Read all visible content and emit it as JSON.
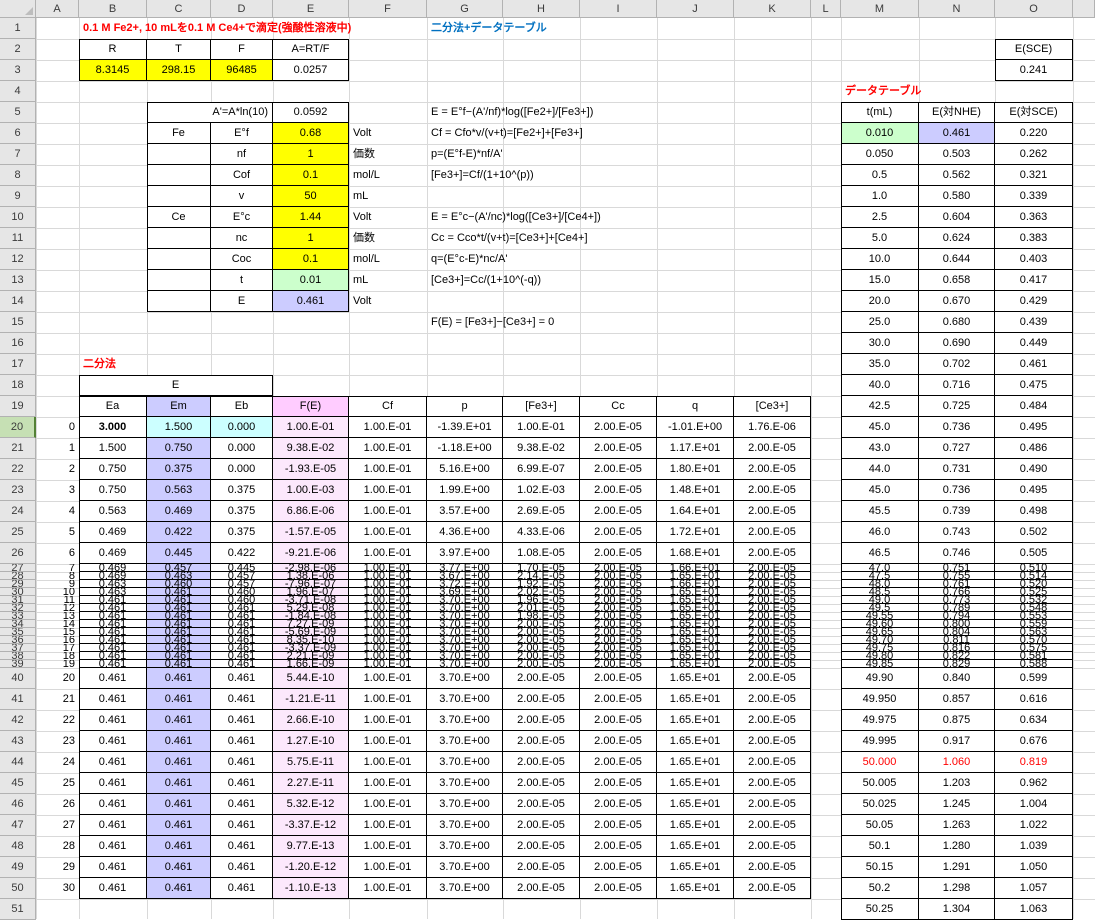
{
  "sheet": {
    "column_letters": [
      "A",
      "B",
      "C",
      "D",
      "E",
      "F",
      "G",
      "H",
      "I",
      "J",
      "K",
      "L",
      "M",
      "N",
      "O"
    ],
    "row_numbers": [
      "1",
      "2",
      "3",
      "4",
      "5",
      "6",
      "7",
      "8",
      "9",
      "10",
      "11",
      "12",
      "13",
      "14",
      "15",
      "16",
      "17",
      "18",
      "19",
      "20",
      "21",
      "22",
      "23",
      "24",
      "25",
      "26",
      "27",
      "28",
      "29",
      "30",
      "31",
      "32",
      "33",
      "34",
      "35",
      "36",
      "37",
      "38",
      "39",
      "40",
      "41",
      "42",
      "43",
      "44",
      "45",
      "46",
      "47",
      "48",
      "49",
      "50",
      "51"
    ]
  },
  "colors": {
    "input_yellow": "#FFFF00",
    "input_green": "#CCFFCC",
    "result_lavender": "#CCCCFF",
    "start_cyan": "#CCFFFF",
    "fe_header_pink": "#FFCCFF",
    "fe_cell_pink": "#FCE8FC",
    "alert_red": "#FF0000",
    "subtitle_blue": "#0070C0",
    "selected_header_green": "#C6E0B4"
  },
  "top": {
    "title": "0.1 M Fe2+, 10 mLを0.1 M Ce4+で滴定(強酸性溶液中)",
    "subtitle": "二分法+データテーブル"
  },
  "constants_table": {
    "headers": [
      "R",
      "T",
      "F",
      "A=RT/F"
    ],
    "values": [
      "8.3145",
      "298.15",
      "96485",
      "0.0257"
    ]
  },
  "esce_box": {
    "label": "E(SCE)",
    "value": "0.241"
  },
  "params": {
    "a_prime_label": "A'=A*ln(10)",
    "a_prime_value": "0.0592",
    "rows": [
      {
        "group": "Fe",
        "label": "E°f",
        "value": "0.68",
        "unit": "Volt",
        "fill": "yellow"
      },
      {
        "group": "",
        "label": "nf",
        "value": "1",
        "unit": "価数",
        "fill": "yellow"
      },
      {
        "group": "",
        "label": "Cof",
        "value": "0.1",
        "unit": "mol/L",
        "fill": "yellow"
      },
      {
        "group": "",
        "label": "v",
        "value": "50",
        "unit": "mL",
        "fill": "yellow"
      },
      {
        "group": "Ce",
        "label": "E°c",
        "value": "1.44",
        "unit": "Volt",
        "fill": "yellow"
      },
      {
        "group": "",
        "label": "nc",
        "value": "1",
        "unit": "価数",
        "fill": "yellow"
      },
      {
        "group": "",
        "label": "Coc",
        "value": "0.1",
        "unit": "mol/L",
        "fill": "yellow"
      },
      {
        "group": "",
        "label": "t",
        "value": "0.01",
        "unit": "mL",
        "fill": "green"
      },
      {
        "group": "",
        "label": "E",
        "value": "0.461",
        "unit": "Volt",
        "fill": "lavender"
      }
    ]
  },
  "formulas": [
    {
      "row": 5,
      "text": "E = E°f−(A'/nf)*log([Fe2+]/[Fe3+])"
    },
    {
      "row": 6,
      "text": "Cf = Cfo*v/(v+t)=[Fe2+]+[Fe3+]"
    },
    {
      "row": 7,
      "text": "p=(E°f-E)*nf/A'"
    },
    {
      "row": 8,
      "text": "[Fe3+]=Cf/(1+10^(p))"
    },
    {
      "row": 10,
      "text": "E = E°c−(A'/nc)*log([Ce3+]/[Ce4+])"
    },
    {
      "row": 11,
      "text": "Cc = Cco*t/(v+t)=[Ce3+]+[Ce4+]"
    },
    {
      "row": 12,
      "text": "q=(E°c-E)*nc/A'"
    },
    {
      "row": 13,
      "text": "[Ce3+]=Cc/(1+10^(-q))"
    },
    {
      "row": 15,
      "text": "F(E) = [Fe3+]−[Ce3+] = 0"
    }
  ],
  "bisection": {
    "section_label": "二分法",
    "merged_header": "E",
    "headers": [
      "Ea",
      "Em",
      "Eb",
      "F(E)",
      "Cf",
      "p",
      "[Fe3+]",
      "Cc",
      "q",
      "[Ce3+]"
    ],
    "rows": [
      [
        "0",
        "3.000",
        "1.500",
        "0.000",
        "1.00.E-01",
        "1.00.E-01",
        "-1.39.E+01",
        "1.00.E-01",
        "2.00.E-05",
        "-1.01.E+00",
        "1.76.E-06"
      ],
      [
        "1",
        "1.500",
        "0.750",
        "0.000",
        "9.38.E-02",
        "1.00.E-01",
        "-1.18.E+00",
        "9.38.E-02",
        "2.00.E-05",
        "1.17.E+01",
        "2.00.E-05"
      ],
      [
        "2",
        "0.750",
        "0.375",
        "0.000",
        "-1.93.E-05",
        "1.00.E-01",
        "5.16.E+00",
        "6.99.E-07",
        "2.00.E-05",
        "1.80.E+01",
        "2.00.E-05"
      ],
      [
        "3",
        "0.750",
        "0.563",
        "0.375",
        "1.00.E-03",
        "1.00.E-01",
        "1.99.E+00",
        "1.02.E-03",
        "2.00.E-05",
        "1.48.E+01",
        "2.00.E-05"
      ],
      [
        "4",
        "0.563",
        "0.469",
        "0.375",
        "6.86.E-06",
        "1.00.E-01",
        "3.57.E+00",
        "2.69.E-05",
        "2.00.E-05",
        "1.64.E+01",
        "2.00.E-05"
      ],
      [
        "5",
        "0.469",
        "0.422",
        "0.375",
        "-1.57.E-05",
        "1.00.E-01",
        "4.36.E+00",
        "4.33.E-06",
        "2.00.E-05",
        "1.72.E+01",
        "2.00.E-05"
      ],
      [
        "6",
        "0.469",
        "0.445",
        "0.422",
        "-9.21.E-06",
        "1.00.E-01",
        "3.97.E+00",
        "1.08.E-05",
        "2.00.E-05",
        "1.68.E+01",
        "2.00.E-05"
      ],
      [
        "7",
        "0.469",
        "0.457",
        "0.445",
        "-2.98.E-06",
        "1.00.E-01",
        "3.77.E+00",
        "1.70.E-05",
        "2.00.E-05",
        "1.66.E+01",
        "2.00.E-05"
      ],
      [
        "8",
        "0.469",
        "0.463",
        "0.457",
        "1.38.E-06",
        "1.00.E-01",
        "3.67.E+00",
        "2.14.E-05",
        "2.00.E-05",
        "1.65.E+01",
        "2.00.E-05"
      ],
      [
        "9",
        "0.463",
        "0.460",
        "0.457",
        "-7.96.E-07",
        "1.00.E-01",
        "3.72.E+00",
        "1.92.E-05",
        "2.00.E-05",
        "1.66.E+01",
        "2.00.E-05"
      ],
      [
        "10",
        "0.463",
        "0.461",
        "0.460",
        "1.96.E-07",
        "1.00.E-01",
        "3.69.E+00",
        "2.02.E-05",
        "2.00.E-05",
        "1.65.E+01",
        "2.00.E-05"
      ],
      [
        "11",
        "0.461",
        "0.461",
        "0.460",
        "-3.71.E-08",
        "1.00.E-01",
        "3.70.E+00",
        "1.96.E-05",
        "2.00.E-05",
        "1.65.E+01",
        "2.00.E-05"
      ],
      [
        "12",
        "0.461",
        "0.461",
        "0.461",
        "5.29.E-08",
        "1.00.E-01",
        "3.70.E+00",
        "2.01.E-05",
        "2.00.E-05",
        "1.65.E+01",
        "2.00.E-05"
      ],
      [
        "13",
        "0.461",
        "0.461",
        "0.461",
        "-1.84.E-08",
        "1.00.E-01",
        "3.70.E+00",
        "1.98.E-05",
        "2.00.E-05",
        "1.65.E+01",
        "2.00.E-05"
      ],
      [
        "14",
        "0.461",
        "0.461",
        "0.461",
        "7.27.E-09",
        "1.00.E-01",
        "3.70.E+00",
        "2.00.E-05",
        "2.00.E-05",
        "1.65.E+01",
        "2.00.E-05"
      ],
      [
        "15",
        "0.461",
        "0.461",
        "0.461",
        "-5.69.E-09",
        "1.00.E-01",
        "3.70.E+00",
        "2.00.E-05",
        "2.00.E-05",
        "1.65.E+01",
        "2.00.E-05"
      ],
      [
        "16",
        "0.461",
        "0.461",
        "0.461",
        "8.35.E-10",
        "1.00.E-01",
        "3.70.E+00",
        "2.00.E-05",
        "2.00.E-05",
        "1.65.E+01",
        "2.00.E-05"
      ],
      [
        "17",
        "0.461",
        "0.461",
        "0.461",
        "-3.37.E-09",
        "1.00.E-01",
        "3.70.E+00",
        "2.00.E-05",
        "2.00.E-05",
        "1.65.E+01",
        "2.00.E-05"
      ],
      [
        "18",
        "0.461",
        "0.461",
        "0.461",
        "2.21.E-09",
        "1.00.E-01",
        "3.70.E+00",
        "2.00.E-05",
        "2.00.E-05",
        "1.65.E+01",
        "2.00.E-05"
      ],
      [
        "19",
        "0.461",
        "0.461",
        "0.461",
        "1.66.E-09",
        "1.00.E-01",
        "3.70.E+00",
        "2.00.E-05",
        "2.00.E-05",
        "1.65.E+01",
        "2.00.E-05"
      ],
      [
        "20",
        "0.461",
        "0.461",
        "0.461",
        "5.44.E-10",
        "1.00.E-01",
        "3.70.E+00",
        "2.00.E-05",
        "2.00.E-05",
        "1.65.E+01",
        "2.00.E-05"
      ],
      [
        "21",
        "0.461",
        "0.461",
        "0.461",
        "-1.21.E-11",
        "1.00.E-01",
        "3.70.E+00",
        "2.00.E-05",
        "2.00.E-05",
        "1.65.E+01",
        "2.00.E-05"
      ],
      [
        "22",
        "0.461",
        "0.461",
        "0.461",
        "2.66.E-10",
        "1.00.E-01",
        "3.70.E+00",
        "2.00.E-05",
        "2.00.E-05",
        "1.65.E+01",
        "2.00.E-05"
      ],
      [
        "23",
        "0.461",
        "0.461",
        "0.461",
        "1.27.E-10",
        "1.00.E-01",
        "3.70.E+00",
        "2.00.E-05",
        "2.00.E-05",
        "1.65.E+01",
        "2.00.E-05"
      ],
      [
        "24",
        "0.461",
        "0.461",
        "0.461",
        "5.75.E-11",
        "1.00.E-01",
        "3.70.E+00",
        "2.00.E-05",
        "2.00.E-05",
        "1.65.E+01",
        "2.00.E-05"
      ],
      [
        "25",
        "0.461",
        "0.461",
        "0.461",
        "2.27.E-11",
        "1.00.E-01",
        "3.70.E+00",
        "2.00.E-05",
        "2.00.E-05",
        "1.65.E+01",
        "2.00.E-05"
      ],
      [
        "26",
        "0.461",
        "0.461",
        "0.461",
        "5.32.E-12",
        "1.00.E-01",
        "3.70.E+00",
        "2.00.E-05",
        "2.00.E-05",
        "1.65.E+01",
        "2.00.E-05"
      ],
      [
        "27",
        "0.461",
        "0.461",
        "0.461",
        "-3.37.E-12",
        "1.00.E-01",
        "3.70.E+00",
        "2.00.E-05",
        "2.00.E-05",
        "1.65.E+01",
        "2.00.E-05"
      ],
      [
        "28",
        "0.461",
        "0.461",
        "0.461",
        "9.77.E-13",
        "1.00.E-01",
        "3.70.E+00",
        "2.00.E-05",
        "2.00.E-05",
        "1.65.E+01",
        "2.00.E-05"
      ],
      [
        "29",
        "0.461",
        "0.461",
        "0.461",
        "-1.20.E-12",
        "1.00.E-01",
        "3.70.E+00",
        "2.00.E-05",
        "2.00.E-05",
        "1.65.E+01",
        "2.00.E-05"
      ],
      [
        "30",
        "0.461",
        "0.461",
        "0.461",
        "-1.10.E-13",
        "1.00.E-01",
        "3.70.E+00",
        "2.00.E-05",
        "2.00.E-05",
        "1.65.E+01",
        "2.00.E-05"
      ]
    ]
  },
  "datatable": {
    "section_label": "データテーブル",
    "headers": [
      "t(mL)",
      "E(対NHE)",
      "E(対SCE)"
    ],
    "rows": [
      [
        "0.010",
        "0.461",
        "0.220"
      ],
      [
        "0.050",
        "0.503",
        "0.262"
      ],
      [
        "0.5",
        "0.562",
        "0.321"
      ],
      [
        "1.0",
        "0.580",
        "0.339"
      ],
      [
        "2.5",
        "0.604",
        "0.363"
      ],
      [
        "5.0",
        "0.624",
        "0.383"
      ],
      [
        "10.0",
        "0.644",
        "0.403"
      ],
      [
        "15.0",
        "0.658",
        "0.417"
      ],
      [
        "20.0",
        "0.670",
        "0.429"
      ],
      [
        "25.0",
        "0.680",
        "0.439"
      ],
      [
        "30.0",
        "0.690",
        "0.449"
      ],
      [
        "35.0",
        "0.702",
        "0.461"
      ],
      [
        "40.0",
        "0.716",
        "0.475"
      ],
      [
        "42.5",
        "0.725",
        "0.484"
      ],
      [
        "45.0",
        "0.736",
        "0.495"
      ],
      [
        "43.0",
        "0.727",
        "0.486"
      ],
      [
        "44.0",
        "0.731",
        "0.490"
      ],
      [
        "45.0",
        "0.736",
        "0.495"
      ],
      [
        "45.5",
        "0.739",
        "0.498"
      ],
      [
        "46.0",
        "0.743",
        "0.502"
      ],
      [
        "46.5",
        "0.746",
        "0.505"
      ],
      [
        "47.0",
        "0.751",
        "0.510"
      ],
      [
        "47.5",
        "0.755",
        "0.514"
      ],
      [
        "48.0",
        "0.761",
        "0.520"
      ],
      [
        "48.5",
        "0.766",
        "0.525"
      ],
      [
        "49.0",
        "0.773",
        "0.532"
      ],
      [
        "49.5",
        "0.789",
        "0.548"
      ],
      [
        "49.55",
        "0.794",
        "0.553"
      ],
      [
        "49.60",
        "0.800",
        "0.559"
      ],
      [
        "49.65",
        "0.804",
        "0.563"
      ],
      [
        "49.70",
        "0.811",
        "0.570"
      ],
      [
        "49.75",
        "0.816",
        "0.575"
      ],
      [
        "49.80",
        "0.822",
        "0.581"
      ],
      [
        "49.85",
        "0.829",
        "0.588"
      ],
      [
        "49.90",
        "0.840",
        "0.599"
      ],
      [
        "49.950",
        "0.857",
        "0.616"
      ],
      [
        "49.975",
        "0.875",
        "0.634"
      ],
      [
        "49.995",
        "0.917",
        "0.676"
      ],
      [
        "50.000",
        "1.060",
        "0.819"
      ],
      [
        "50.005",
        "1.203",
        "0.962"
      ],
      [
        "50.025",
        "1.245",
        "1.004"
      ],
      [
        "50.05",
        "1.263",
        "1.022"
      ],
      [
        "50.1",
        "1.280",
        "1.039"
      ],
      [
        "50.15",
        "1.291",
        "1.050"
      ],
      [
        "50.2",
        "1.298",
        "1.057"
      ],
      [
        "50.25",
        "1.304",
        "1.063"
      ]
    ]
  }
}
